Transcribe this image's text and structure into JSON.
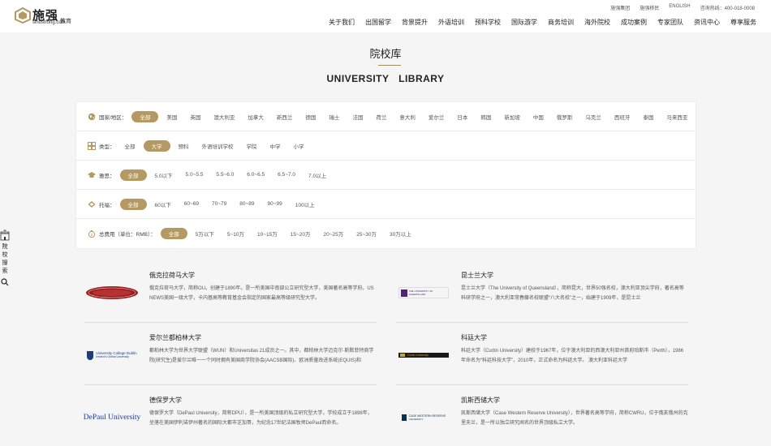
{
  "header": {
    "logo_cn": "施强",
    "logo_edu": "教育",
    "logo_sub": "sinostrong.com",
    "util_links": [
      "施强集团",
      "施强移民",
      "ENGLISH",
      "咨询热线：400-018-0008"
    ],
    "nav": [
      "关于我们",
      "出国留学",
      "背景提升",
      "外语培训",
      "预科学校",
      "国际游学",
      "商务培训",
      "海外院校",
      "成功案例",
      "专家团队",
      "资讯中心",
      "尊享服务"
    ]
  },
  "page": {
    "title_cn": "院校库",
    "title_en": "UNIVERSITY LIBRARY"
  },
  "filters": {
    "country": {
      "label": "国家/地区：",
      "options": [
        "全部",
        "美国",
        "英国",
        "澳大利亚",
        "加拿大",
        "新西兰",
        "德国",
        "瑞士",
        "法国",
        "荷兰",
        "意大利",
        "爱尔兰",
        "日本",
        "韩国",
        "新加坡",
        "中国",
        "俄罗斯",
        "乌克兰",
        "西班牙",
        "泰国",
        "马来西亚"
      ],
      "selected": 0
    },
    "type": {
      "label": "类型：",
      "options": [
        "全部",
        "大学",
        "预科",
        "外语培训学校",
        "学院",
        "中学",
        "小学"
      ],
      "selected": 1
    },
    "ielts": {
      "label": "雅思：",
      "options": [
        "全部",
        "5.0以下",
        "5.0~5.5",
        "5.5~6.0",
        "6.0~6.5",
        "6.5~7.0",
        "7.0以上"
      ],
      "selected": 0
    },
    "toefl": {
      "label": "托福：",
      "options": [
        "全部",
        "60以下",
        "60~69",
        "70~79",
        "80~89",
        "90~99",
        "100以上"
      ],
      "selected": 0
    },
    "cost": {
      "label": "总费用（单位：RMB）：",
      "options": [
        "全部",
        "5万以下",
        "5~10万",
        "10~15万",
        "15~20万",
        "20~25万",
        "25~30万",
        "30万以上"
      ],
      "selected": 0
    }
  },
  "universities": [
    {
      "name": "俄克拉荷马大学",
      "logo_text": "",
      "desc": "俄克拉荷马大学，简称OU。创建于1890年。是一所美国中南部公立研究型大学，美国著名高等学府。US NEWS美国一级大学，卡内基高等教育基金会指定的国家最高等级研究型大学。"
    },
    {
      "name": "昆士兰大学",
      "logo_text": "THE UNIVERSITY OF QUEENSLAND",
      "desc": "昆士兰大学（The University of Queensland），简称昆大，世界50强名校，澳大利亚顶尖学府，著名高等科研学府之一，澳大利亚常春藤名校联盟“八大名校”之一，始建于1909年，是昆士兰"
    },
    {
      "name": "爱尔兰都柏林大学",
      "logo_text": "University College Dublin",
      "logo_sub": "Ireland's Global University",
      "desc": "都柏林大学为世界大学联盟（WUN）和Universitas 21成员之一。其中，都柏林大学迈克尔·斯默菲特商学院(研究生)是爱尔兰唯一一个同时拥有美国商学院协会(AACSB国际)、欧洲质量改进系统(EQUIS)和"
    },
    {
      "name": "科廷大学",
      "logo_text": "Curtin University",
      "desc": "科廷大学（Curtin University）建校于1967年，位于澳大利亚的西澳大利亚州首府珀斯市（Perth），1986年命名为“科廷科技大学”，2010年，正式命名为科廷大学。 澳大利亚科廷大学"
    },
    {
      "name": "德保罗大学",
      "logo_text": "DePaul University",
      "desc": "德保罗大学（DePaul University，简称DPU），是一所美国顶级的私立研究型大学，学校成立于1898年，坐落在美国伊利诺伊州著名的国际大都市芝加哥，为纪念17世纪法国牧师DePaul而命名。"
    },
    {
      "name": "凯斯西储大学",
      "logo_text": "CASE WESTERN RESERVE",
      "logo_sub": "UNIVERSITY",
      "desc": "凯斯西储大学（Case Western Reserve University），世界著名高等学府，简称CWRU，位于俄亥俄州的克里夫兰，是一所以独立研究闻名的世界顶级私立大学。"
    }
  ],
  "sidebar": {
    "label": "院校搜索"
  },
  "colors": {
    "accent": "#b49a62",
    "background": "#f5f5f5"
  }
}
